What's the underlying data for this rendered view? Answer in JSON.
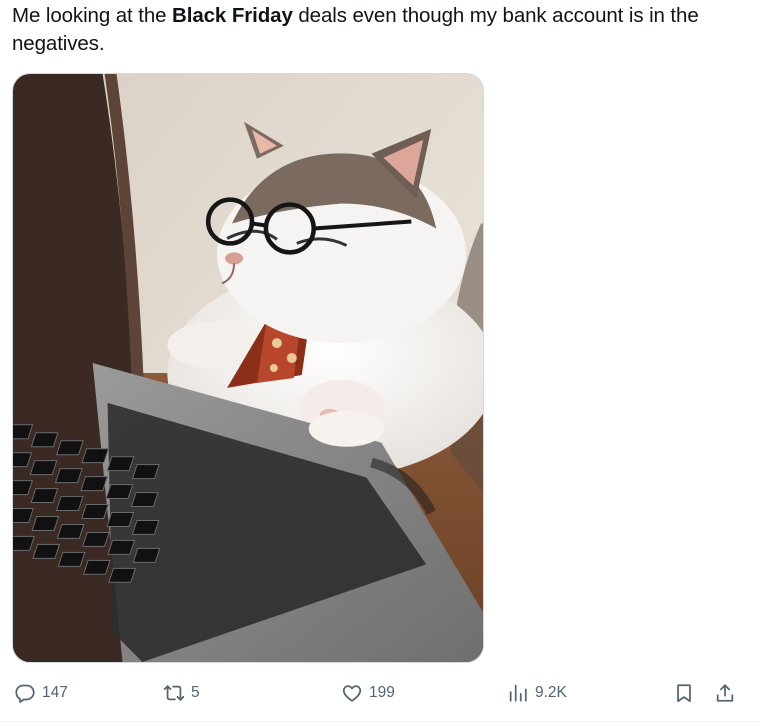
{
  "tweet": {
    "text_before": "Me looking at the ",
    "text_bold": "Black Friday",
    "text_after": " deals even though my bank account is in the negatives."
  },
  "media": {
    "kind": "gif",
    "subject": "cat"
  },
  "actions": {
    "reply_count": "147",
    "retweet_count": "5",
    "like_count": "199",
    "views_count": "9.2K"
  },
  "colors": {
    "text": "#0f1419",
    "muted": "#536471",
    "border": "#cfd9de"
  },
  "icons": [
    "reply-icon",
    "retweet-icon",
    "like-icon",
    "views-icon",
    "bookmark-icon",
    "share-icon"
  ]
}
